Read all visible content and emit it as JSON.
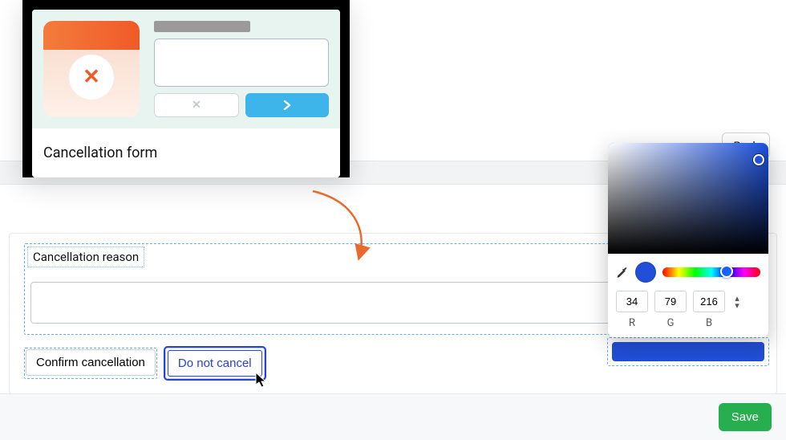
{
  "preview": {
    "label": "Cancellation form"
  },
  "back": {
    "label": "Back"
  },
  "form": {
    "reason_label": "Cancellation reason",
    "buttons": {
      "confirm": "Confirm cancellation",
      "cancel": "Do not cancel"
    }
  },
  "footer": {
    "save": "Save"
  },
  "color_picker": {
    "r": "34",
    "g": "79",
    "b": "216",
    "r_label": "R",
    "g_label": "G",
    "b_label": "B",
    "swatch": "#224fd8"
  }
}
